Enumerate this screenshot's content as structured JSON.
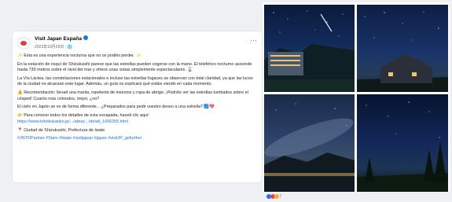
{
  "post": {
    "page_name": "Visit Japan España",
    "meta": "2023年10月29日 · 🌐",
    "paragraphs": [
      "✨ Esta es una experiencia nocturna que no os podéis perder. ✨",
      "En la estación de esquí de Shizukuishi parece que las estrellas pueden cogerse con la mano. El teleférico nocturno asciende hasta 730 metros sobre el nivel del mar y ofrece unas vistas simplemente espectaculares. 🚡",
      "La Vía Láctea, las constelaciones estacionales e incluso las estrellas fugaces se observan con total claridad, ya que las luces de la ciudad no alcanzan este lugar. Además, un guía os explicará qué estáis viendo en cada momento.",
      "⚠️ Recomendación: llevad una manta, repelente de insectos y ropa de abrigo. ¡Podréis ver las estrellas tumbados sobre el césped! Cuanto más cómodos, mejor, ¿no?",
      "El cielo en Japón se ve de forma diferente... ¿Preparados para pedir vuestro deseo a una estrella? 🗾💖",
      "👉 Para conocer todos los detalles de esta escapada, haced clic aquí:"
    ],
    "link": "https://www.tohokukanko.jp/.../attrac.../detail_1006250.html",
    "location": "📍 Ciudad de Shizukuishi, Prefectura de Iwate",
    "hashtags": "#JNTOPartner #Stars #Iwate #visitjapan #japan #visitJP_gofurther"
  },
  "photos": [
    {
      "name": "photo-1",
      "description_icon": "starry-sky-building-icon"
    },
    {
      "name": "photo-2",
      "description_icon": "starry-sky-house-icon"
    },
    {
      "name": "photo-3",
      "description_icon": "milky-way-valley-icon"
    },
    {
      "name": "photo-4",
      "description_icon": "starry-sky-trees-icon"
    }
  ],
  "reactions": {
    "count": "7"
  }
}
